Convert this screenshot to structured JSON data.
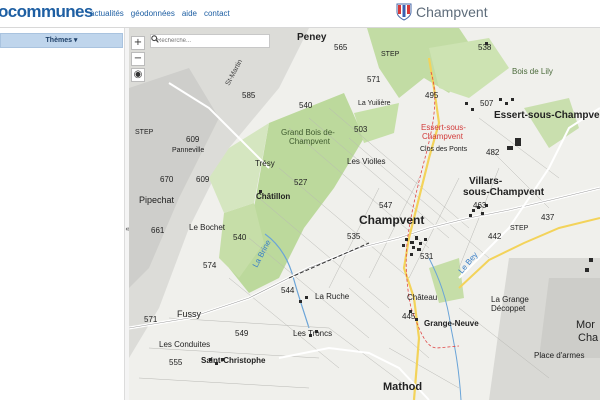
{
  "header": {
    "brand": "ocommunes",
    "nav": [
      "actualités",
      "géodonnées",
      "aide",
      "contact"
    ],
    "commune": "Champvent"
  },
  "sidebar": {
    "themes_label": "Thèmes ▾",
    "collapse_glyph": "«"
  },
  "map": {
    "search_placeholder": "Recherche...",
    "zoom_in": "+",
    "zoom_out": "−",
    "locate": "◉",
    "labels": {
      "peney": "Peney",
      "n565": "565",
      "n538": "538",
      "bois_de_lily": "Bois de Lily",
      "step1": "STEP",
      "n585": "585",
      "st_martin": "St-Martin",
      "n540a": "540",
      "la_yuiliere": "La Yuilière",
      "n571a": "571",
      "n495": "495",
      "n507": "507",
      "essert": "Essert-sous-Champvent",
      "essert_red": "Essert-sous-",
      "essert_red2": "Champvent",
      "step2": "STEP",
      "n609a": "609",
      "panneville": "Panneville",
      "grand_bois": "Grand Bois de-",
      "champvent_small": "Champvent",
      "n503": "503",
      "clos_des_ponts": "Clos des Ponts",
      "n482": "482",
      "les_violles": "Les Violles",
      "tresy": "Trésy",
      "n670": "670",
      "n609b": "609",
      "n527": "527",
      "villars": "Villars-",
      "villars2": "sous-Champvent",
      "pipechat": "Pipechat",
      "chatillon": "Châtillon",
      "n463": "463",
      "n547": "547",
      "n437": "437",
      "champvent": "Champvent",
      "n661": "661",
      "le_bochet": "Le Bochet",
      "n540b": "540",
      "n535": "535",
      "n442": "442",
      "step3": "STEP",
      "la_brine": "La Brine",
      "n531": "531",
      "le_bey": "Le Bey",
      "n574": "574",
      "n544": "544",
      "la_ruche": "La Ruche",
      "chateau": "Château",
      "la_grange": "La Grange",
      "decoppet": "Décoppet",
      "fussy": "Fussy",
      "n571b": "571",
      "n445": "445",
      "grange_neuve": "Grange-Neuve",
      "n549": "549",
      "les_troncs": "Les Troncs",
      "les_conduites": "Les Conduites",
      "n555": "555",
      "st_christophe": "Saint-Christophe",
      "place_darmes": "Place d'armes",
      "mathod": "Mathod",
      "mor": "Mor",
      "cha": "Cha"
    }
  }
}
